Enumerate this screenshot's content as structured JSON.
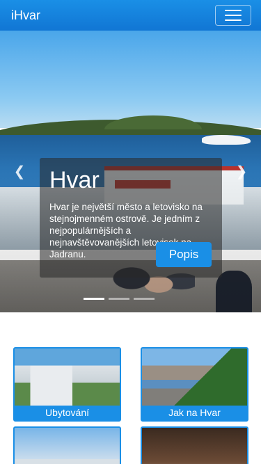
{
  "navbar": {
    "brand": "iHvar",
    "menu_icon": "hamburger-menu-icon"
  },
  "carousel": {
    "prev_icon": "chevron-left-icon",
    "next_icon": "chevron-right-icon",
    "prev_glyph": "❮",
    "next_glyph": "❯",
    "caption": {
      "title": "Hvar",
      "text": "Hvar je největší město a letovisko na stejnojmenném ostrově. Je jedním z nejpopulárnějších a nejnavštěvovanějších letovisek na Jadranu.",
      "button": "Popis"
    }
  },
  "tiles": [
    {
      "label": "Ubytování"
    },
    {
      "label": "Jak na Hvar"
    },
    {
      "label": ""
    },
    {
      "label": ""
    }
  ],
  "colors": {
    "primary": "#1a8fe6"
  }
}
